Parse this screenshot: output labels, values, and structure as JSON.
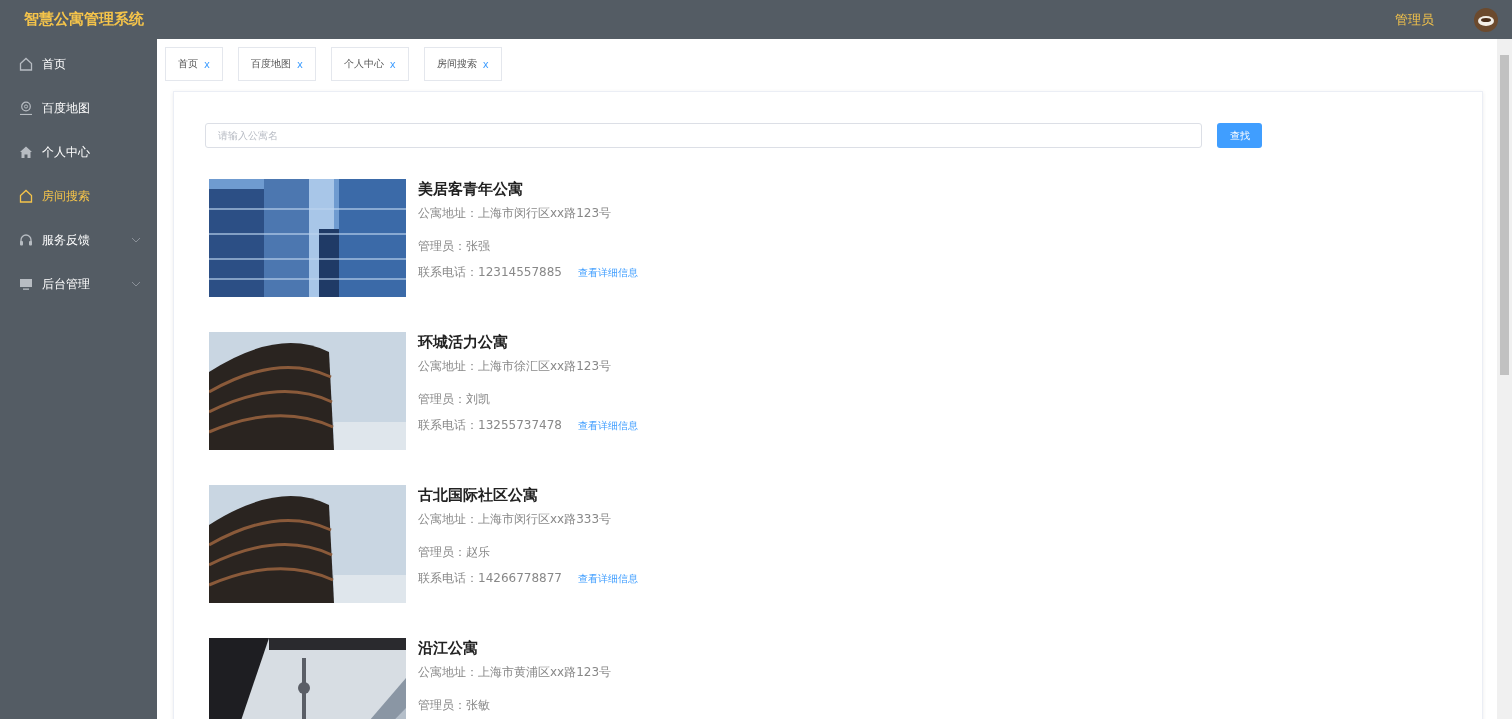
{
  "header": {
    "title": "智慧公寓管理系统",
    "user": "管理员"
  },
  "sidebar": {
    "items": [
      {
        "label": "首页",
        "selected": false,
        "expandable": false
      },
      {
        "label": "百度地图",
        "selected": false,
        "expandable": false
      },
      {
        "label": "个人中心",
        "selected": false,
        "expandable": false
      },
      {
        "label": "房间搜索",
        "selected": true,
        "expandable": false
      },
      {
        "label": "服务反馈",
        "selected": false,
        "expandable": true
      },
      {
        "label": "后台管理",
        "selected": false,
        "expandable": true
      }
    ]
  },
  "tabs": [
    {
      "label": "首页",
      "close": "x"
    },
    {
      "label": "百度地图",
      "close": "x"
    },
    {
      "label": "个人中心",
      "close": "x"
    },
    {
      "label": "房间搜索",
      "close": "x"
    }
  ],
  "search": {
    "placeholder": "请输入公寓名",
    "button": "查找"
  },
  "listings": [
    {
      "name": "美居客青年公寓",
      "address": "公寓地址：上海市闵行区xx路123号",
      "manager": "管理员：张强",
      "phone": "联系电话：12314557885",
      "link": "查看详细信息"
    },
    {
      "name": "环城活力公寓",
      "address": "公寓地址：上海市徐汇区xx路123号",
      "manager": "管理员：刘凯",
      "phone": "联系电话：13255737478",
      "link": "查看详细信息"
    },
    {
      "name": "古北国际社区公寓",
      "address": "公寓地址：上海市闵行区xx路333号",
      "manager": "管理员：赵乐",
      "phone": "联系电话：14266778877",
      "link": "查看详细信息"
    },
    {
      "name": "沿江公寓",
      "address": "公寓地址：上海市黄浦区xx路123号",
      "manager": "管理员：张敏"
    }
  ]
}
